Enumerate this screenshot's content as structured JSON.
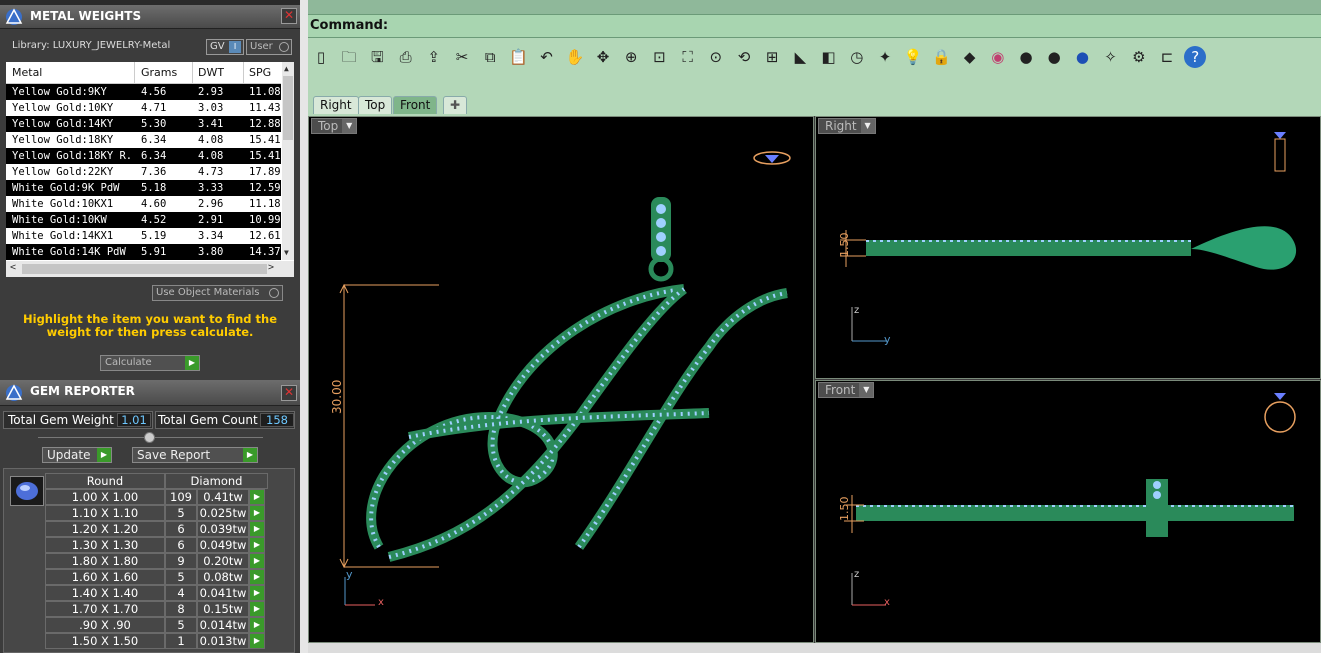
{
  "metal_panel": {
    "title": "METAL WEIGHTS",
    "library_label": "Library: LUXURY_JEWELRY-Metal",
    "gv_label": "GV",
    "user_label": "User",
    "columns": [
      "Metal",
      "Grams",
      "DWT",
      "SPG"
    ],
    "rows": [
      {
        "metal": "Yellow Gold:9KY",
        "grams": "4.56",
        "dwt": "2.93",
        "spg": "11.08"
      },
      {
        "metal": "Yellow Gold:10KY",
        "grams": "4.71",
        "dwt": "3.03",
        "spg": "11.43"
      },
      {
        "metal": "Yellow Gold:14KY",
        "grams": "5.30",
        "dwt": "3.41",
        "spg": "12.88"
      },
      {
        "metal": "Yellow Gold:18KY",
        "grams": "6.34",
        "dwt": "4.08",
        "spg": "15.41"
      },
      {
        "metal": "Yellow Gold:18KY R...",
        "grams": "6.34",
        "dwt": "4.08",
        "spg": "15.41"
      },
      {
        "metal": "Yellow Gold:22KY",
        "grams": "7.36",
        "dwt": "4.73",
        "spg": "17.89"
      },
      {
        "metal": "White Gold:9K PdW",
        "grams": "5.18",
        "dwt": "3.33",
        "spg": "12.59"
      },
      {
        "metal": "White Gold:10KX1",
        "grams": "4.60",
        "dwt": "2.96",
        "spg": "11.18"
      },
      {
        "metal": "White Gold:10KW",
        "grams": "4.52",
        "dwt": "2.91",
        "spg": "10.99"
      },
      {
        "metal": "White Gold:14KX1",
        "grams": "5.19",
        "dwt": "3.34",
        "spg": "12.61"
      },
      {
        "metal": "White Gold:14K PdW",
        "grams": "5.91",
        "dwt": "3.80",
        "spg": "14.37"
      }
    ],
    "use_object_materials": "Use Object Materials",
    "instruction": "Highlight the item you want to find the weight for then press calculate.",
    "calculate_label": "Calculate"
  },
  "gem_panel": {
    "title": "GEM REPORTER",
    "total_weight_label": "Total Gem Weight",
    "total_weight_value": "1.01",
    "total_count_label": "Total Gem Count",
    "total_count_value": "158",
    "update_label": "Update",
    "save_label": "Save Report",
    "col_shape": "Round",
    "col_stone": "Diamond",
    "rows": [
      {
        "size": "1.00 X 1.00",
        "count": "109",
        "tw": "0.41tw"
      },
      {
        "size": "1.10 X 1.10",
        "count": "5",
        "tw": "0.025tw"
      },
      {
        "size": "1.20 X 1.20",
        "count": "6",
        "tw": "0.039tw"
      },
      {
        "size": "1.30 X 1.30",
        "count": "6",
        "tw": "0.049tw"
      },
      {
        "size": "1.80 X 1.80",
        "count": "9",
        "tw": "0.20tw"
      },
      {
        "size": "1.60 X 1.60",
        "count": "5",
        "tw": "0.08tw"
      },
      {
        "size": "1.40 X 1.40",
        "count": "4",
        "tw": "0.041tw"
      },
      {
        "size": "1.70 X 1.70",
        "count": "8",
        "tw": "0.15tw"
      },
      {
        "size": ".90 X .90",
        "count": "5",
        "tw": "0.014tw"
      },
      {
        "size": "1.50 X 1.50",
        "count": "1",
        "tw": "0.013tw"
      }
    ]
  },
  "command": {
    "label": "Command:"
  },
  "viewport_tabs": [
    "Right",
    "Top",
    "Front"
  ],
  "viewports": {
    "top": {
      "label": "Top",
      "dim": "30.00",
      "axis_a": "y",
      "axis_b": "x"
    },
    "right": {
      "label": "Right",
      "dim": "1.50",
      "axis_a": "z",
      "axis_b": "y"
    },
    "front": {
      "label": "Front",
      "dim": "1.50",
      "axis_a": "z",
      "axis_b": "x"
    }
  },
  "colors": {
    "accent": "#ffcc00",
    "model": "#2fa070",
    "gem": "#9fc8ff",
    "dimension": "#e8a060"
  }
}
